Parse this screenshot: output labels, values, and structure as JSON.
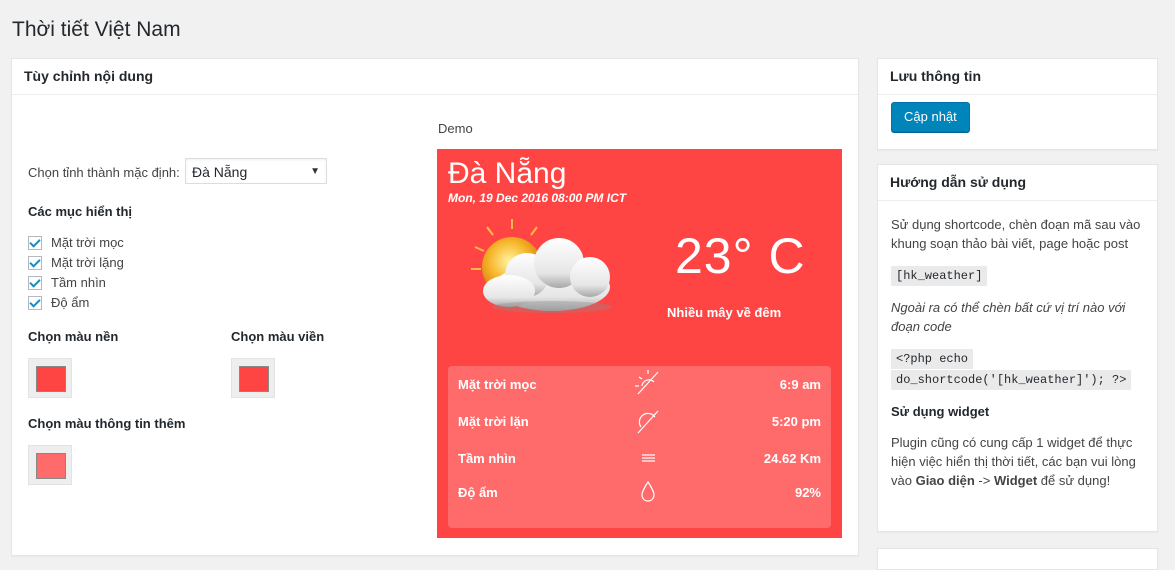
{
  "page": {
    "title": "Thời tiết Việt Nam"
  },
  "main_box": {
    "title": "Tùy chỉnh nội dung",
    "province_label": "Chọn tỉnh thành mặc định:",
    "province_selected": "Đà Nẵng",
    "display_title": "Các mục hiển thị",
    "checkboxes": [
      {
        "label": "Mặt trời mọc",
        "checked": true
      },
      {
        "label": "Mặt trời lặng",
        "checked": true
      },
      {
        "label": "Tầm nhìn",
        "checked": true
      },
      {
        "label": "Độ ẩm",
        "checked": true
      }
    ],
    "bg_color_label": "Chọn màu nền",
    "border_color_label": "Chọn màu viền",
    "extra_color_label": "Chọn màu thông tin thêm",
    "bg_color": "#ff4444",
    "border_color": "#ff4444",
    "extra_color": "#ff6b6b"
  },
  "demo": {
    "label": "Demo",
    "city": "Đà Nẵng",
    "date": "Mon, 19 Dec 2016 08:00 PM ICT",
    "temperature": "23° C",
    "description": "Nhiều mây về đêm",
    "card_color": "#ff4444",
    "info_color": "#ff6b6b",
    "weather_icon": "partly-cloudy-icon",
    "rows": [
      {
        "label": "Mặt trời mọc",
        "icon": "sunrise-icon",
        "value": "6:9 am"
      },
      {
        "label": "Mặt trời lặn",
        "icon": "sunset-icon",
        "value": "5:20 pm"
      },
      {
        "label": "Tầm nhìn",
        "icon": "visibility-icon",
        "value": "24.62 Km"
      },
      {
        "label": "Độ ẩm",
        "icon": "humidity-icon",
        "value": "92%"
      }
    ]
  },
  "save_box": {
    "title": "Lưu thông tin",
    "button": "Cập nhật"
  },
  "guide_box": {
    "title": "Hướng dẫn sử dụng",
    "p1": "Sử dụng shortcode, chèn đoạn mã sau vào khung soạn thảo bài viết, page hoặc post",
    "shortcode": "[hk_weather]",
    "p2": "Ngoài ra có thể chèn bất cứ vị trí nào với đoạn code",
    "php_code_line1": "<?php echo",
    "php_code_line2": "do_shortcode('[hk_weather]'); ?>",
    "widget_title": "Sử dụng widget",
    "p3_start": "Plugin cũng có cung cấp 1 widget để thực hiện việc hiển thị thời tiết, các bạn vui lòng vào ",
    "p3_menu": "Giao diện",
    "p3_arrow": " -> ",
    "p3_widget": "Widget",
    "p3_end": " để sử dụng!"
  }
}
